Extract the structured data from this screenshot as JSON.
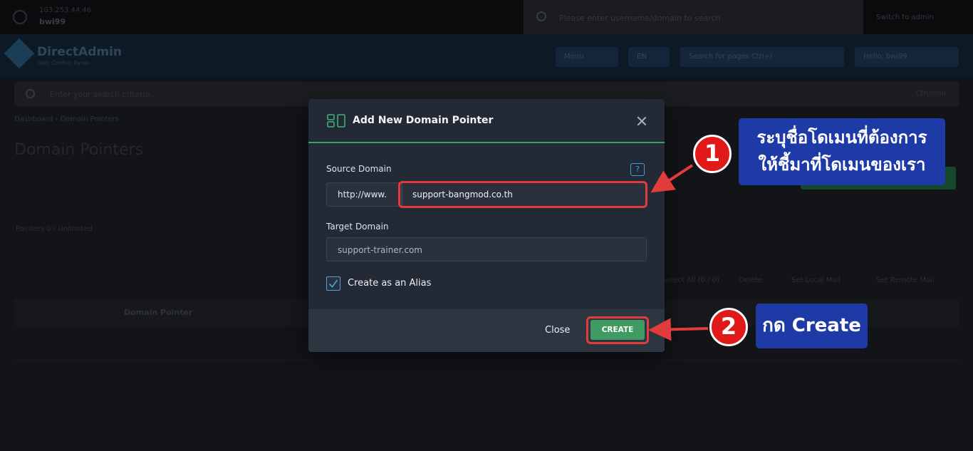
{
  "background": {
    "user_ip": "103.253.44.46",
    "user_name": "bwi99",
    "global_search_placeholder": "Please enter username/domain to search",
    "switch_label": "Switch to admin",
    "brand_title": "DirectAdmin",
    "brand_subtitle": "Web Control Panel",
    "nav": [
      "Menu",
      "EN",
      "Search for pages  Ctrl+/",
      "Hello, bwi99"
    ],
    "search_placeholder": "Enter your search criteria...",
    "search_key": "Ctrl/cmd",
    "breadcrumb": "Dashboard  ›  Domain Pointers",
    "page_title": "Domain Pointers",
    "pointers_stat": "Pointers  0 / Unlimited",
    "tabs": [
      "Select All (0 / 0)",
      "Delete",
      "Set Local Mail",
      "Set Remote Mail"
    ],
    "table_header": "Domain Pointer"
  },
  "modal": {
    "title": "Add New Domain Pointer",
    "source_label": "Source Domain",
    "help_glyph": "?",
    "prefix": "http://www.",
    "source_value": "support-bangmod.co.th",
    "target_label": "Target Domain",
    "target_value": "support-trainer.com",
    "alias_label": "Create as an Alias",
    "alias_checked": true,
    "close_label": "Close",
    "create_label": "CREATE"
  },
  "annotations": {
    "step1_number": "1",
    "step1_line1": "ระบุชื่อโดเมนที่ต้องการ",
    "step1_line2": "ให้ชี้มาที่โดเมนของเรา",
    "step2_number": "2",
    "step2_text": "กด Create",
    "highlight_color": "#e23b3b",
    "callout_color": "#1d3aa6"
  }
}
